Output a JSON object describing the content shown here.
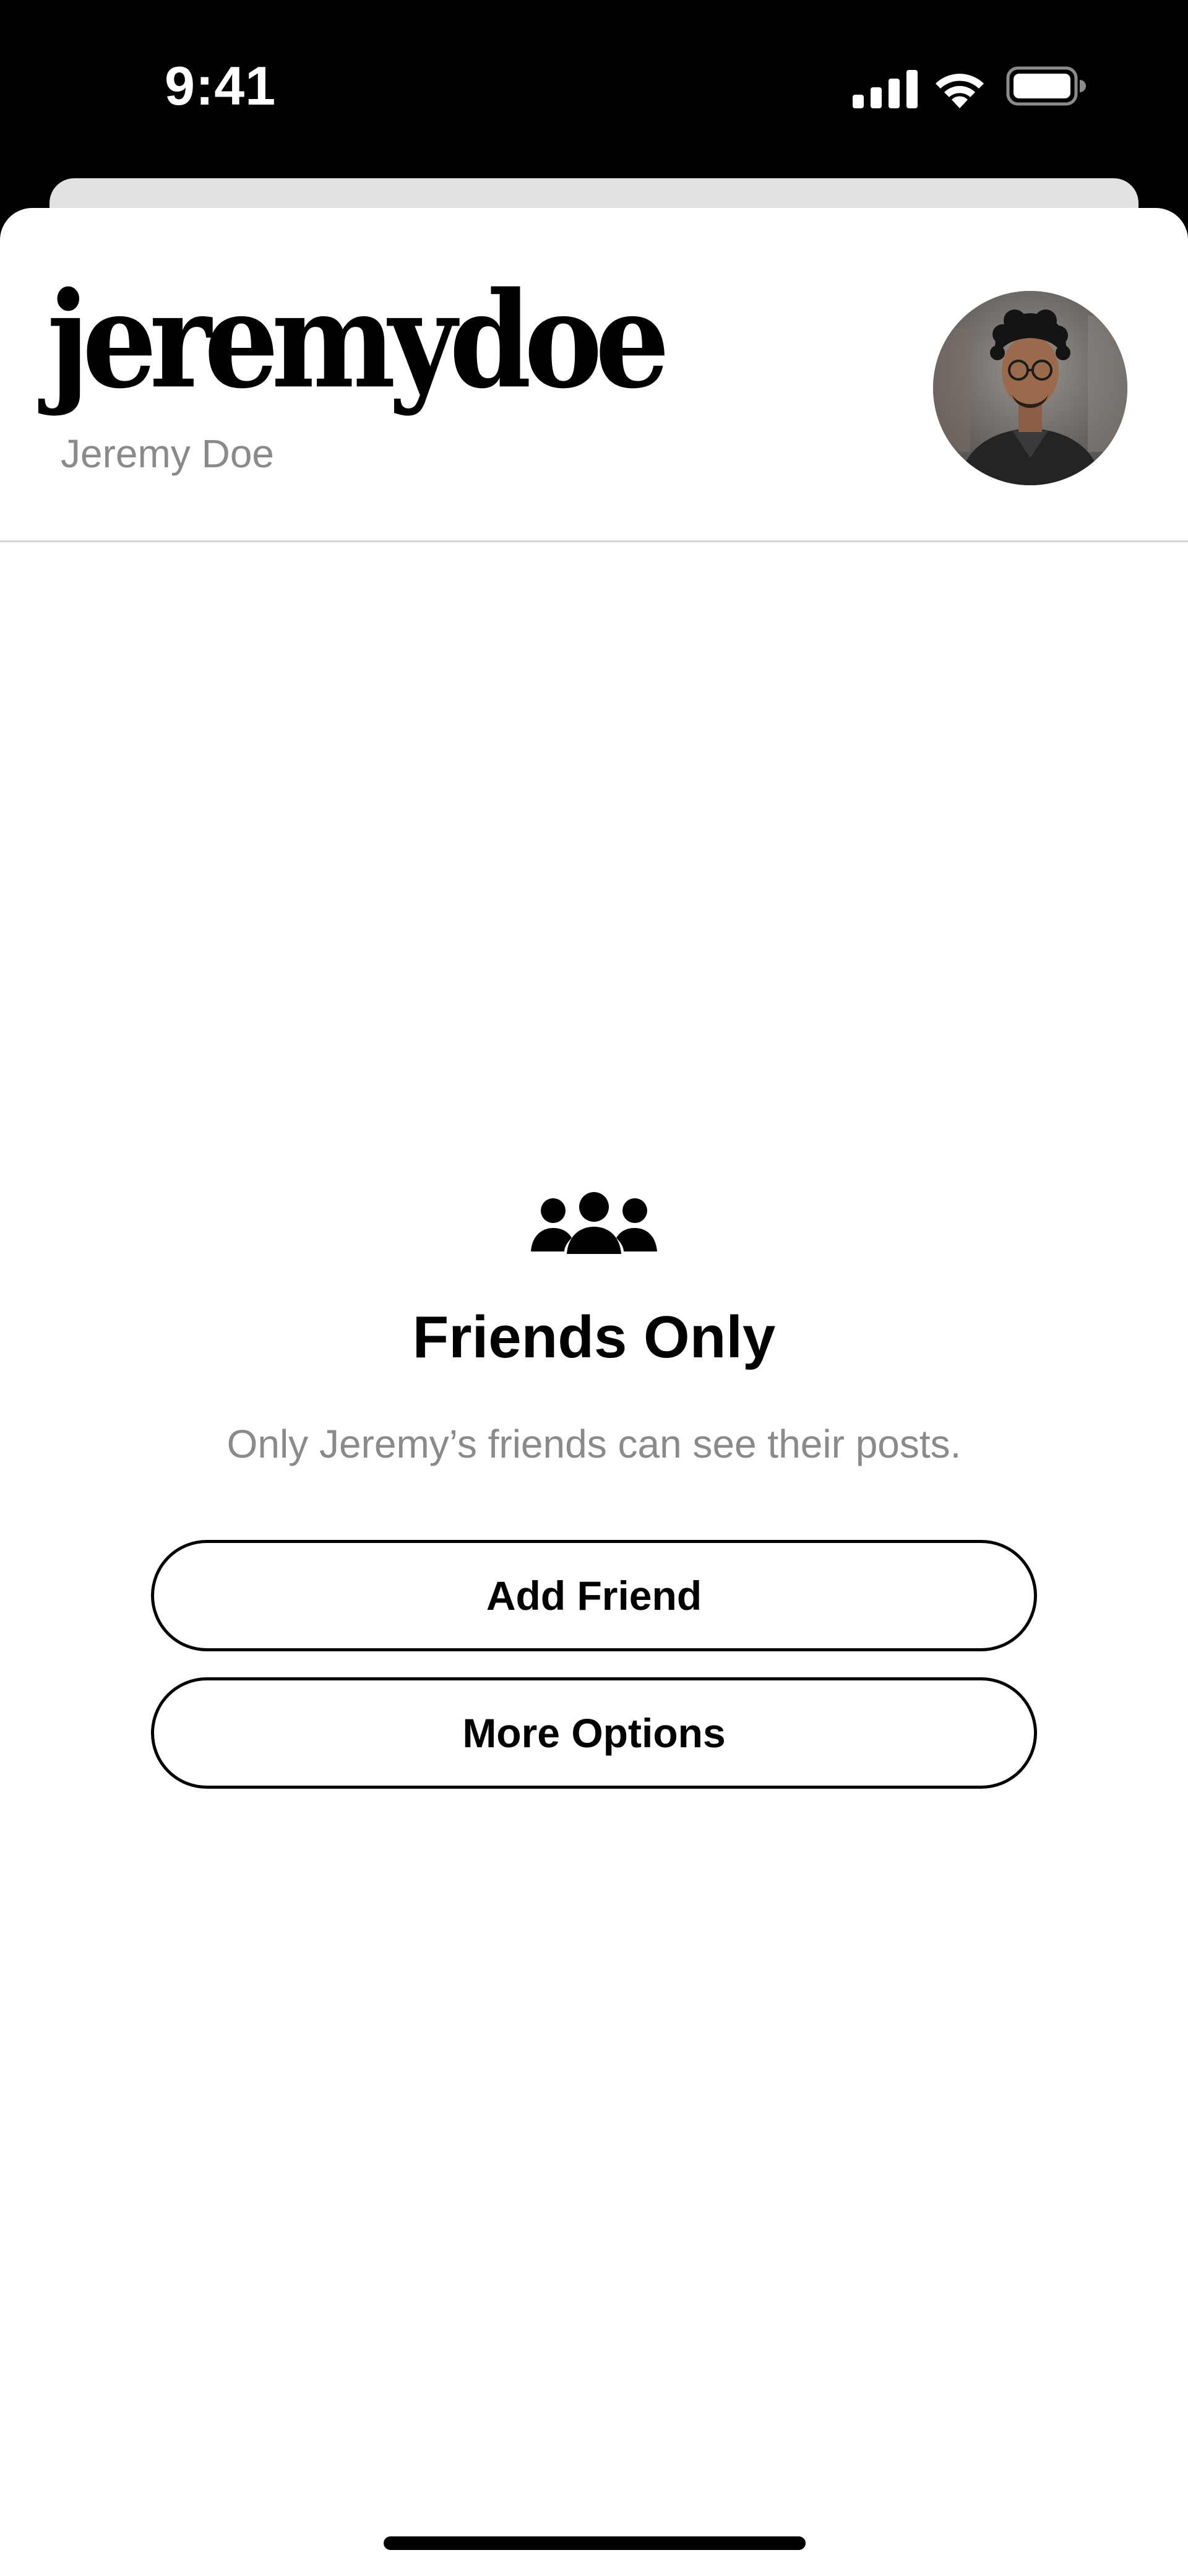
{
  "status_bar": {
    "time": "9:41",
    "icons": [
      "cellular-signal-icon",
      "wifi-icon",
      "battery-icon"
    ]
  },
  "profile": {
    "username": "jeremydoe",
    "display_name": "Jeremy Doe",
    "avatar_icon": "avatar"
  },
  "privacy": {
    "icon": "friends-group-icon",
    "title": "Friends Only",
    "subtitle": "Only Jeremy’s friends can see their posts."
  },
  "actions": {
    "add_friend_label": "Add Friend",
    "more_options_label": "More Options"
  },
  "colors": {
    "background": "#ffffff",
    "text_primary": "#000000",
    "text_secondary": "#8a8a8a",
    "divider": "#d6d6d6"
  }
}
